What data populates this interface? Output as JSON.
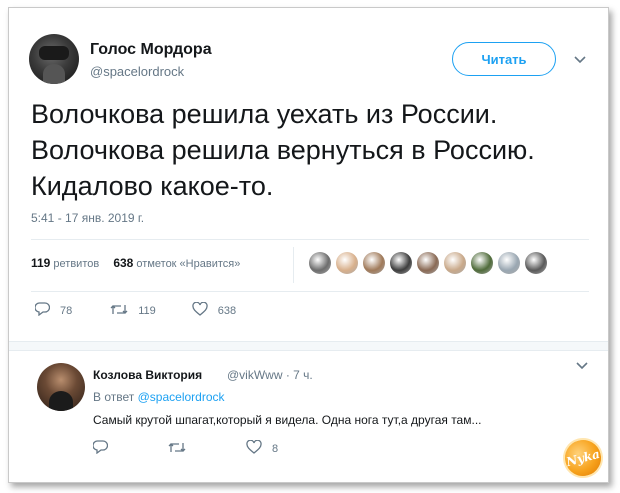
{
  "tweet": {
    "author_name": "Голос Мордора",
    "author_handle": "@spacelordrock",
    "follow_label": "Читать",
    "text_lines": [
      "Волочкова решила уехать из России.",
      "Волочкова решила вернуться в Россию.",
      "Кидалово какое-то."
    ],
    "timestamp": "5:41 - 17 янв. 2019 г.",
    "retweet_count": "119",
    "retweet_label": "ретвитов",
    "like_count": "638",
    "like_label": "отметок «Нравится»",
    "liker_colors": [
      "#6d6d6d",
      "#d8b08c",
      "#a07a5a",
      "#3d3d3d",
      "#8a6a55",
      "#c9a98a",
      "#4f6b3a",
      "#9aa7b2",
      "#5a5a5a"
    ],
    "actions": {
      "replies": "78",
      "retweets": "119",
      "likes": "638"
    }
  },
  "reply": {
    "author_name": "Козлова Виктория",
    "author_handle": "@vikWww · 7 ч.",
    "in_reply_label": "В ответ",
    "in_reply_handle": "@spacelordrock",
    "text": "Самый крутой шпагат,который я видела. Одна нога тут,а другая там...",
    "actions": {
      "replies": "",
      "retweets": "",
      "likes": "8"
    }
  },
  "icons": {
    "caret": "⌄",
    "reply": "💬",
    "retweet": "⇄",
    "like": "♡"
  },
  "watermark": "Nyka"
}
